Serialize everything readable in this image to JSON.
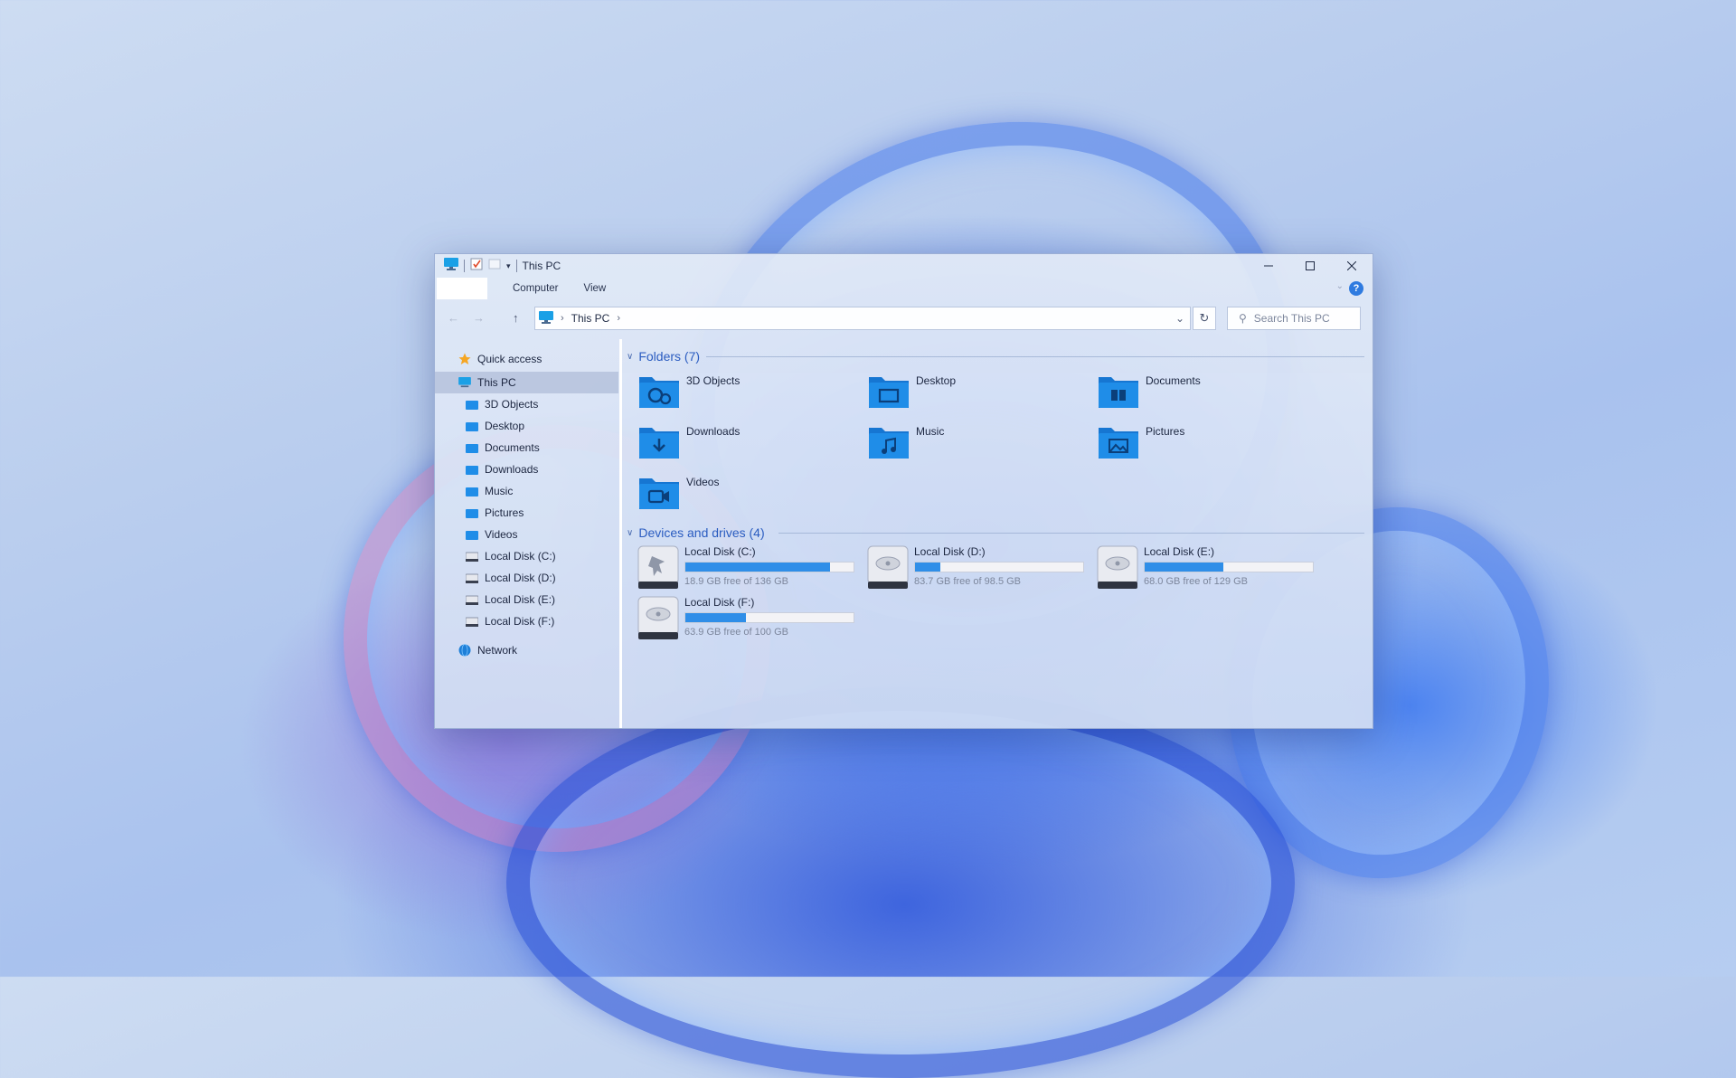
{
  "window": {
    "title": "This PC"
  },
  "ribbon": {
    "tabs": [
      {
        "label": "Computer"
      },
      {
        "label": "View"
      }
    ],
    "help": "?"
  },
  "address": {
    "crumbs": [
      "This PC"
    ]
  },
  "search": {
    "placeholder": "Search This PC"
  },
  "nav": {
    "quick_access": "Quick access",
    "this_pc": "This PC",
    "items": [
      "3D Objects",
      "Desktop",
      "Documents",
      "Downloads",
      "Music",
      "Pictures",
      "Videos",
      "Local Disk (C:)",
      "Local Disk (D:)",
      "Local Disk (E:)",
      "Local Disk (F:)"
    ],
    "network": "Network"
  },
  "folders": {
    "header": "Folders (7)",
    "items": [
      "3D Objects",
      "Desktop",
      "Documents",
      "Downloads",
      "Music",
      "Pictures",
      "Videos"
    ]
  },
  "drives": {
    "header": "Devices and drives (4)",
    "items": [
      {
        "name": "Local Disk (C:)",
        "free": "18.9 GB free of 136 GB",
        "used_fraction": 0.86
      },
      {
        "name": "Local Disk (D:)",
        "free": "83.7 GB free of 98.5 GB",
        "used_fraction": 0.15
      },
      {
        "name": "Local Disk (E:)",
        "free": "68.0 GB free of 129 GB",
        "used_fraction": 0.47
      },
      {
        "name": "Local Disk (F:)",
        "free": "63.9 GB free of 100 GB",
        "used_fraction": 0.36
      }
    ]
  },
  "colors": {
    "accent": "#2f8ee8",
    "folder": "#1f8de8",
    "header_text": "#2a5cc0"
  }
}
